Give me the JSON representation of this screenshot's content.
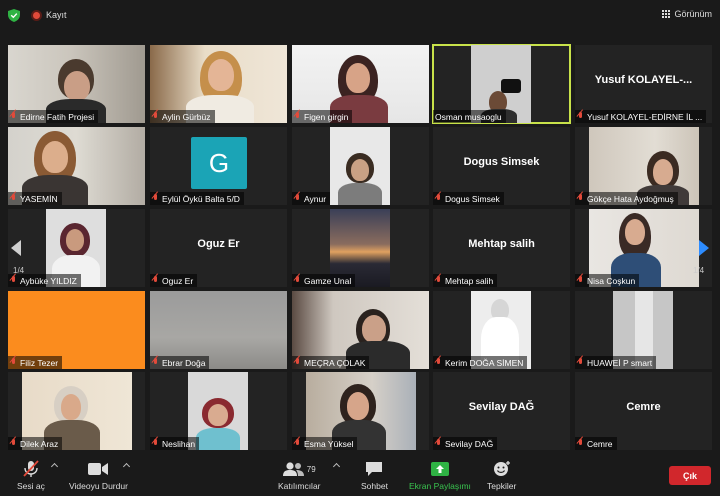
{
  "topbar": {
    "record_label": "Kayıt",
    "view_label": "Görünüm",
    "colors": {
      "shield": "#2fb344",
      "record": "#e24a3a"
    }
  },
  "participants": [
    {
      "name": "Edirne Fatih Projesi",
      "muted": true,
      "kind": "video"
    },
    {
      "name": "Aylin Gürbüz",
      "muted": true,
      "kind": "video"
    },
    {
      "name": "Figen girgin",
      "muted": true,
      "kind": "video"
    },
    {
      "name": "Osman musaoglu",
      "muted": false,
      "kind": "video",
      "active_speaker": true
    },
    {
      "name": "Yusuf KOLAYEL-EDİRNE İL ...",
      "display": "Yusuf  KOLAYEL-...",
      "muted": true,
      "kind": "name"
    },
    {
      "name": "YASEMİN",
      "muted": true,
      "kind": "video"
    },
    {
      "name": "Eylül Öykü Balta 5/D",
      "avatar_letter": "G",
      "muted": true,
      "kind": "avatar"
    },
    {
      "name": "Aynur",
      "muted": true,
      "kind": "video"
    },
    {
      "name": "Dogus Simsek",
      "display": "Dogus Simsek",
      "muted": true,
      "kind": "name"
    },
    {
      "name": "Gökçe Hata Aydoğmuş",
      "muted": true,
      "kind": "video"
    },
    {
      "name": "Aybüke YILDIZ",
      "muted": true,
      "kind": "video"
    },
    {
      "name": "Oguz Er",
      "display": "Oguz Er",
      "muted": true,
      "kind": "name"
    },
    {
      "name": "Gamze Unal",
      "muted": true,
      "kind": "video"
    },
    {
      "name": "Mehtap salih",
      "display": "Mehtap salih",
      "muted": true,
      "kind": "name"
    },
    {
      "name": "Nisa Coşkun",
      "muted": true,
      "kind": "video"
    },
    {
      "name": "Filiz Tezer",
      "muted": true,
      "kind": "video"
    },
    {
      "name": "Ebrar Doğa",
      "muted": true,
      "kind": "video"
    },
    {
      "name": "MEÇRA ÇOLAK",
      "muted": true,
      "kind": "video"
    },
    {
      "name": "Kerim DOĞA SİMEN",
      "muted": true,
      "kind": "video"
    },
    {
      "name": "HUAWEİ P smart",
      "muted": true,
      "kind": "video"
    },
    {
      "name": "Dilek Araz",
      "muted": true,
      "kind": "video"
    },
    {
      "name": "Neslihan",
      "muted": true,
      "kind": "video"
    },
    {
      "name": "Esma Yüksel",
      "muted": true,
      "kind": "video"
    },
    {
      "name": "Sevilay DAĞ",
      "display": "Sevilay DAĞ",
      "muted": true,
      "kind": "name"
    },
    {
      "name": "Cemre",
      "display": "Cemre",
      "muted": true,
      "kind": "name"
    }
  ],
  "pagination": {
    "left": "1/4",
    "right": "1/4"
  },
  "toolbar": {
    "audio": "Sesi aç",
    "video": "Videoyu Durdur",
    "participants": "Katılımcılar",
    "participants_count": "79",
    "chat": "Sohbet",
    "share": "Ekran Paylaşımı",
    "reactions": "Tepkiler",
    "leave": "Çık",
    "colors": {
      "share": "#2fb344",
      "leave": "#d1272c",
      "muted": "#e24a3a"
    }
  }
}
